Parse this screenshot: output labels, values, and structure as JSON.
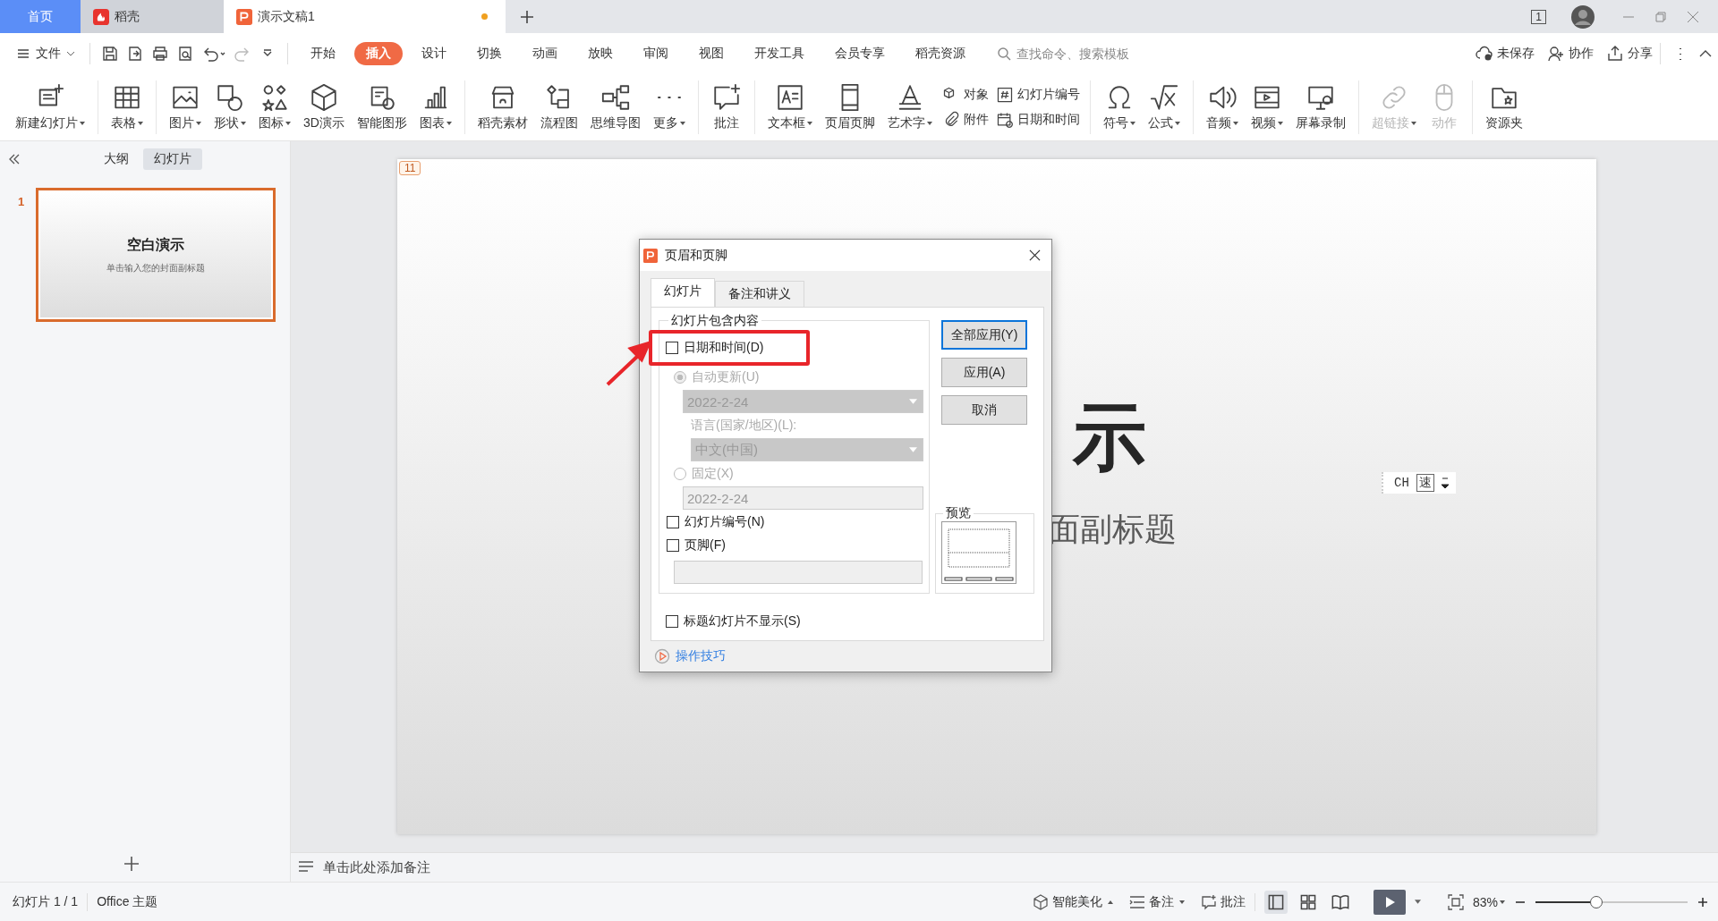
{
  "tabs": [
    {
      "label": "首页",
      "kind": "home",
      "selected": false
    },
    {
      "label": "稻壳",
      "kind": "docer",
      "selected": false
    },
    {
      "label": "演示文稿1",
      "kind": "doc",
      "selected": true,
      "modified": true
    }
  ],
  "window_controls": {
    "count": "1"
  },
  "menu": {
    "file": "文件",
    "tabs": [
      {
        "label": "开始",
        "selected": false
      },
      {
        "label": "插入",
        "selected": true
      },
      {
        "label": "设计",
        "selected": false
      },
      {
        "label": "切换",
        "selected": false
      },
      {
        "label": "动画",
        "selected": false
      },
      {
        "label": "放映",
        "selected": false
      },
      {
        "label": "审阅",
        "selected": false
      },
      {
        "label": "视图",
        "selected": false
      },
      {
        "label": "开发工具",
        "selected": false
      },
      {
        "label": "会员专享",
        "selected": false
      },
      {
        "label": "稻壳资源",
        "selected": false
      }
    ],
    "search": {
      "placeholder": "查找命令、搜索模板"
    },
    "actions": [
      "未保存",
      "协作",
      "分享"
    ]
  },
  "ribbon": {
    "groups": [
      [
        {
          "kind": "large",
          "label": "新建幻灯片",
          "dropdown": true,
          "disabled": false
        }
      ],
      [
        {
          "kind": "large",
          "label": "表格",
          "dropdown": true,
          "disabled": false
        }
      ],
      [
        {
          "kind": "large",
          "label": "图片",
          "dropdown": true,
          "disabled": false
        },
        {
          "kind": "large",
          "label": "形状",
          "dropdown": true,
          "disabled": false
        },
        {
          "kind": "large",
          "label": "图标",
          "dropdown": true,
          "disabled": false
        },
        {
          "kind": "large",
          "label": "3D演示",
          "dropdown": false,
          "disabled": false
        },
        {
          "kind": "large",
          "label": "智能图形",
          "dropdown": false,
          "disabled": false
        },
        {
          "kind": "large",
          "label": "图表",
          "dropdown": true,
          "disabled": false
        }
      ],
      [
        {
          "kind": "large",
          "label": "稻壳素材",
          "dropdown": false,
          "disabled": false
        },
        {
          "kind": "large",
          "label": "流程图",
          "dropdown": false,
          "disabled": false
        },
        {
          "kind": "large",
          "label": "思维导图",
          "dropdown": false,
          "disabled": false
        },
        {
          "kind": "large",
          "label": "更多",
          "dropdown": true,
          "disabled": false
        }
      ],
      [
        {
          "kind": "large",
          "label": "批注",
          "dropdown": false,
          "disabled": false
        }
      ],
      [
        {
          "kind": "large",
          "label": "文本框",
          "dropdown": true,
          "disabled": false
        },
        {
          "kind": "large",
          "label": "页眉页脚",
          "dropdown": false,
          "disabled": false
        },
        {
          "kind": "large",
          "label": "艺术字",
          "dropdown": true,
          "disabled": false
        },
        {
          "kind": "stack",
          "items": [
            {
              "label": "对象"
            },
            {
              "label": "附件"
            }
          ]
        },
        {
          "kind": "stack",
          "items": [
            {
              "label": "幻灯片编号"
            },
            {
              "label": "日期和时间"
            }
          ]
        }
      ],
      [
        {
          "kind": "large",
          "label": "符号",
          "dropdown": true,
          "disabled": false
        },
        {
          "kind": "large",
          "label": "公式",
          "dropdown": true,
          "disabled": false
        }
      ],
      [
        {
          "kind": "large",
          "label": "音频",
          "dropdown": true,
          "disabled": false
        },
        {
          "kind": "large",
          "label": "视频",
          "dropdown": true,
          "disabled": false
        },
        {
          "kind": "large",
          "label": "屏幕录制",
          "dropdown": false,
          "disabled": false
        }
      ],
      [
        {
          "kind": "large",
          "label": "超链接",
          "dropdown": true,
          "disabled": true
        },
        {
          "kind": "large",
          "label": "动作",
          "dropdown": false,
          "disabled": true
        }
      ],
      [
        {
          "kind": "large",
          "label": "资源夹",
          "dropdown": false,
          "disabled": false
        }
      ]
    ]
  },
  "left_panel": {
    "tabs": [
      {
        "label": "大纲",
        "selected": false
      },
      {
        "label": "幻灯片",
        "selected": true
      }
    ],
    "slides": [
      {
        "number": "1",
        "title": "空白演示",
        "subtitle": "单击输入您的封面副标题",
        "selected": true
      }
    ]
  },
  "slide": {
    "badge": "11",
    "title": "示",
    "subtitle": "面副标题"
  },
  "ime": {
    "mode": "CH",
    "key": "速"
  },
  "notes": {
    "placeholder": "单击此处添加备注"
  },
  "dialog": {
    "title": "页眉和页脚",
    "tabs": [
      {
        "label": "幻灯片",
        "selected": true
      },
      {
        "label": "备注和讲义",
        "selected": false
      }
    ],
    "group_label": "幻灯片包含内容",
    "date_time": {
      "label": "日期和时间(D)",
      "checked": false
    },
    "auto_update": {
      "label": "自动更新(U)",
      "selected": true,
      "disabled": true
    },
    "auto_date": {
      "value": "2022-2-24",
      "disabled": true
    },
    "language_label": "语言(国家/地区)(L):",
    "language": {
      "value": "中文(中国)",
      "disabled": true
    },
    "fixed": {
      "label": "固定(X)",
      "selected": false,
      "disabled": true
    },
    "fixed_date": {
      "value": "2022-2-24",
      "disabled": true
    },
    "slide_number": {
      "label": "幻灯片编号(N)",
      "checked": false
    },
    "footer": {
      "label": "页脚(F)",
      "checked": false
    },
    "footer_field": {
      "disabled": true
    },
    "hide_on_title": {
      "label": "标题幻灯片不显示(S)",
      "checked": false
    },
    "buttons": [
      {
        "label": "全部应用(Y)",
        "default": true
      },
      {
        "label": "应用(A)",
        "default": false
      },
      {
        "label": "取消",
        "default": false
      }
    ],
    "preview_label": "预览",
    "help_link": "操作技巧"
  },
  "status_bar": {
    "slide_count": "幻灯片 1 / 1",
    "theme": "Office 主题",
    "beautify": "智能美化",
    "notes": "备注",
    "comments": "批注",
    "views": [
      {
        "selected": true
      },
      {
        "selected": false
      },
      {
        "selected": false
      }
    ],
    "zoom": "83%",
    "zoom_slider": {
      "level": 0.4
    }
  }
}
